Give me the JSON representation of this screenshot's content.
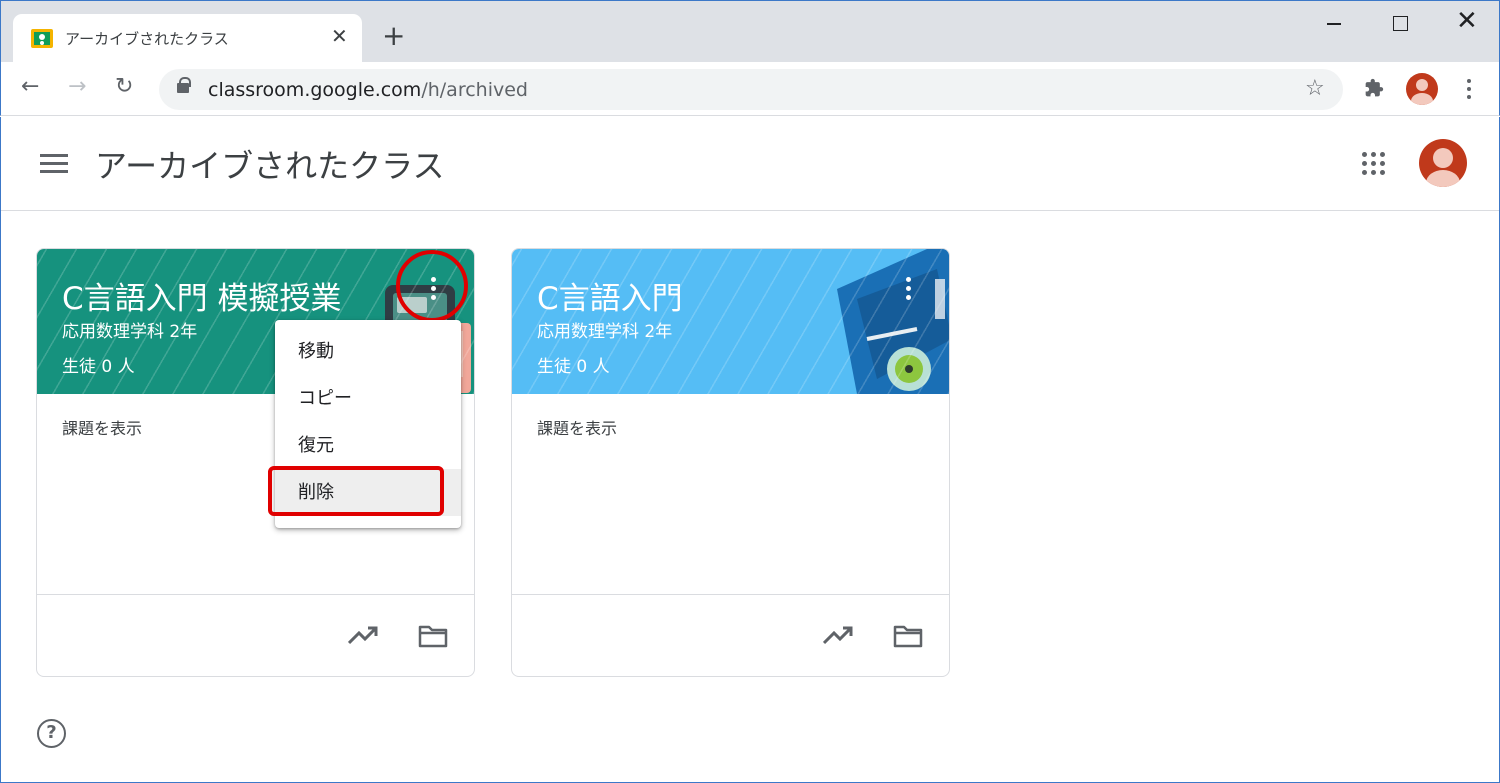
{
  "browser": {
    "tab_title": "アーカイブされたクラス",
    "tab_close": "✕",
    "new_tab": "+",
    "url_host": "classroom.google.com",
    "url_path": "/h/archived",
    "back": "←",
    "forward": "→",
    "reload": "↻",
    "star": "☆",
    "minimize_icon": "minimize-icon",
    "maximize_icon": "maximize-icon",
    "close_window": "✕"
  },
  "app": {
    "title": "アーカイブされたクラス",
    "help": "?"
  },
  "cards": [
    {
      "title": "C言語入門 模擬授業",
      "section": "応用数理学科 2年",
      "students": "生徒 0 人",
      "view_work": "課題を表示",
      "color": "#16927e"
    },
    {
      "title": "C言語入門",
      "section": "応用数理学科 2年",
      "students": "生徒 0 人",
      "view_work": "課題を表示",
      "color": "#55bdf5"
    }
  ],
  "menu": {
    "items": [
      "移動",
      "コピー",
      "復元",
      "削除"
    ],
    "highlighted": "削除"
  },
  "annotation_color": "#e00000"
}
